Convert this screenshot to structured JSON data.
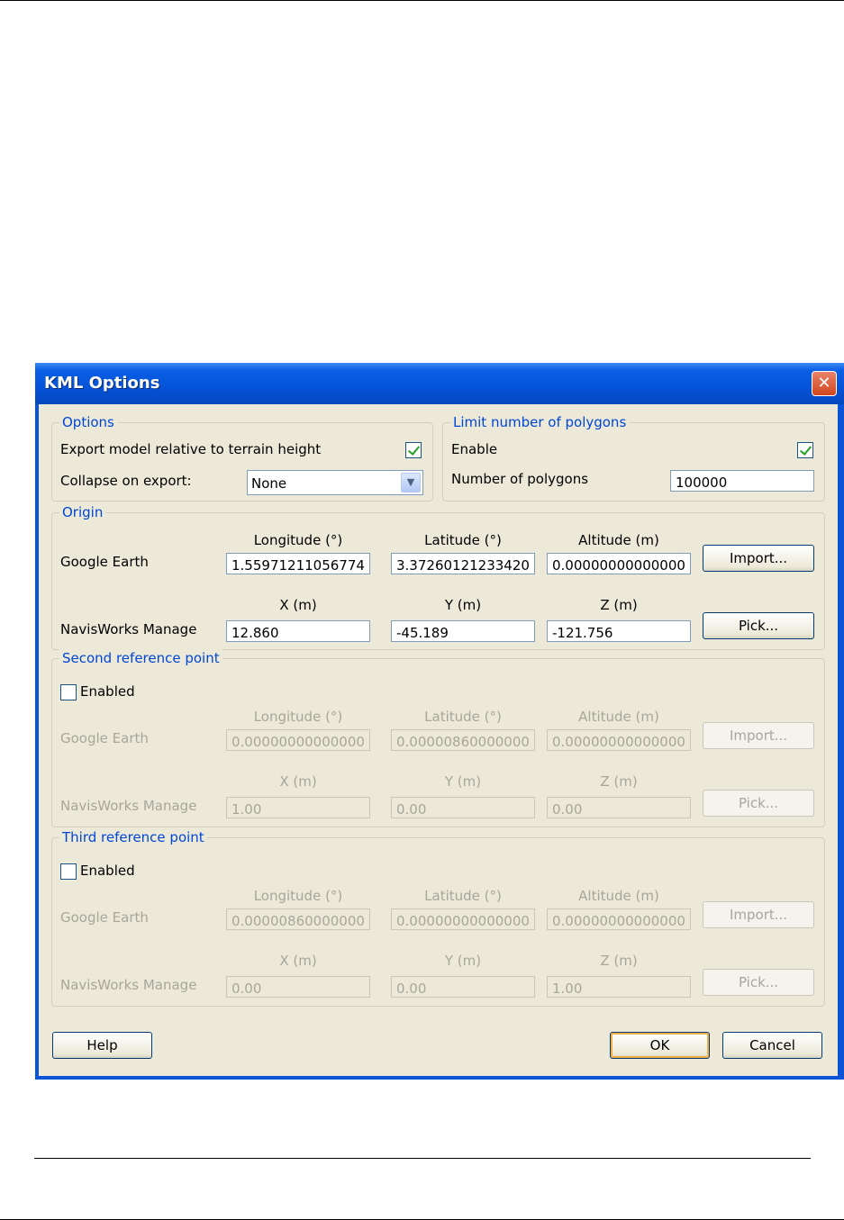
{
  "window": {
    "title": "KML Options"
  },
  "options": {
    "legend": "Options",
    "export_relative_label": "Export model relative to terrain height",
    "export_relative_checked": true,
    "collapse_label": "Collapse on export:",
    "collapse_value": "None"
  },
  "limit": {
    "legend": "Limit number of polygons",
    "enable_label": "Enable",
    "enable_checked": true,
    "polygons_label": "Number of polygons",
    "polygons_value": "100000"
  },
  "origin": {
    "legend": "Origin",
    "ge_label": "Google Earth",
    "nw_label": "NavisWorks Manage",
    "headers": {
      "lon": "Longitude (°)",
      "lat": "Latitude (°)",
      "alt": "Altitude (m)",
      "x": "X (m)",
      "y": "Y (m)",
      "z": "Z (m)"
    },
    "lon": "1.55971211056774",
    "lat": "3.37260121233420",
    "alt": "0.00000000000000",
    "x": "12.860",
    "y": "-45.189",
    "z": "-121.756",
    "import_label": "Import...",
    "pick_label": "Pick..."
  },
  "second": {
    "legend": "Second reference point",
    "enabled_label": "Enabled",
    "ge_label": "Google Earth",
    "nw_label": "NavisWorks Manage",
    "headers": {
      "lon": "Longitude (°)",
      "lat": "Latitude (°)",
      "alt": "Altitude (m)",
      "x": "X (m)",
      "y": "Y (m)",
      "z": "Z (m)"
    },
    "lon": "0.00000000000000",
    "lat": "0.00000860000000",
    "alt": "0.00000000000000",
    "x": "1.00",
    "y": "0.00",
    "z": "0.00",
    "import_label": "Import...",
    "pick_label": "Pick..."
  },
  "third": {
    "legend": "Third reference point",
    "enabled_label": "Enabled",
    "ge_label": "Google Earth",
    "nw_label": "NavisWorks Manage",
    "headers": {
      "lon": "Longitude (°)",
      "lat": "Latitude (°)",
      "alt": "Altitude (m)",
      "x": "X (m)",
      "y": "Y (m)",
      "z": "Z (m)"
    },
    "lon": "0.00000860000000",
    "lat": "0.00000000000000",
    "alt": "0.00000000000000",
    "x": "0.00",
    "y": "0.00",
    "z": "1.00",
    "import_label": "Import...",
    "pick_label": "Pick..."
  },
  "buttons": {
    "help": "Help",
    "ok": "OK",
    "cancel": "Cancel"
  }
}
